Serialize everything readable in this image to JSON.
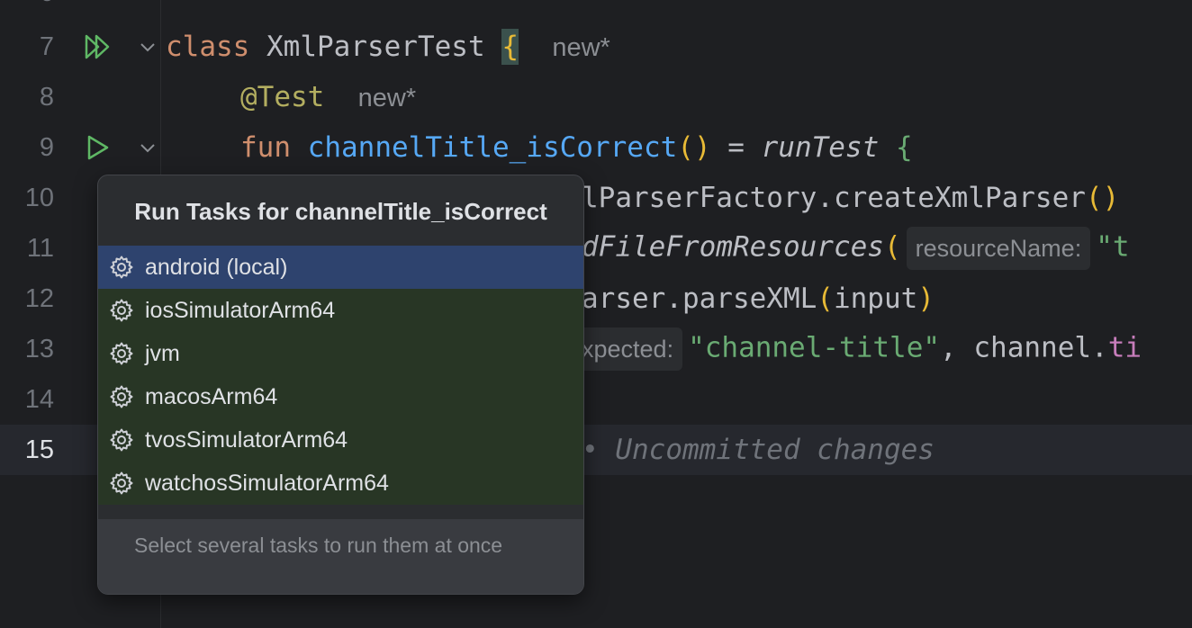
{
  "editor": {
    "lines": [
      {
        "number": "7"
      },
      {
        "number": "8"
      },
      {
        "number": "9"
      },
      {
        "number": "10"
      },
      {
        "number": "11"
      },
      {
        "number": "12"
      },
      {
        "number": "13"
      },
      {
        "number": "14"
      },
      {
        "number": "15"
      }
    ],
    "line7": {
      "kw": "class",
      "name": "XmlParserTest",
      "brace": "{",
      "hint": "new",
      "star": "*"
    },
    "line8": {
      "annotation": "@Test",
      "hint": "new",
      "star": "*"
    },
    "line9": {
      "kw": "fun",
      "fn": "channelTitle_isCorrect",
      "paren": "()",
      "eq": "=",
      "call": "runTest",
      "brace": "{"
    },
    "line10": {
      "text": "lParserFactory.createXmlParser",
      "paren": "()"
    },
    "line11": {
      "text": "dFileFromResources",
      "paren_open": "(",
      "param_hint": "resourceName:",
      "str": "\"t"
    },
    "line12": {
      "text": "arser.parseXML",
      "paren_open": "(",
      "arg": "input",
      "paren_close": ")"
    },
    "line13": {
      "param_hint": "xpected:",
      "str": "\"channel-title\"",
      "rest": ", channel.",
      "prop": "ti"
    },
    "line15": {
      "blame": "• Uncommitted changes"
    }
  },
  "popup": {
    "title": "Run Tasks for channelTitle_isCorrect",
    "items": [
      {
        "label": "android (local)",
        "icon": "gear-icon"
      },
      {
        "label": "iosSimulatorArm64",
        "icon": "gear-icon"
      },
      {
        "label": "jvm",
        "icon": "gear-icon"
      },
      {
        "label": "macosArm64",
        "icon": "gear-icon"
      },
      {
        "label": "tvosSimulatorArm64",
        "icon": "gear-icon"
      },
      {
        "label": "watchosSimulatorArm64",
        "icon": "gear-icon"
      }
    ],
    "selected_index": 0,
    "footer": "Select several tasks to run them at once"
  },
  "colors": {
    "background": "#1e1f22",
    "selection": "#2e436e",
    "list_background": "#283625",
    "keyword": "#cf8e6d",
    "function": "#56a8f5",
    "string": "#6aab73"
  }
}
